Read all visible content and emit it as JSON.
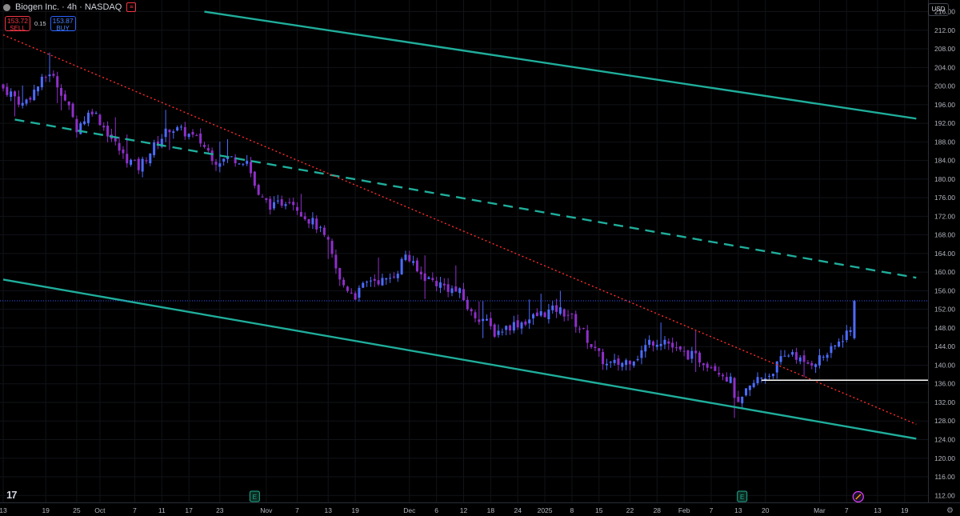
{
  "header": {
    "symbol_title": "Biogen Inc. · 4h · NASDAQ",
    "sell_price": "153.72",
    "sell_label": "SELL",
    "spread": "0.15",
    "buy_price": "153.87",
    "buy_label": "BUY",
    "currency": "USD"
  },
  "icons": {
    "logo": "tradingview-logo",
    "settings": "gear-icon",
    "earnings": "earnings-marker-icon",
    "dividend": "dividend-marker-icon"
  },
  "colors": {
    "up": "#4c6cff",
    "down": "#8f2fc9",
    "channel": "#1fae9b",
    "trendline": "#ff2b2b",
    "price_line": "#3656ff",
    "level_line": "#ffffff",
    "last_price_bg": "#2962ff"
  },
  "chart_data": {
    "type": "candlestick",
    "interval": "4h",
    "y_axis": {
      "ticks": [
        "112.00",
        "116.00",
        "120.00",
        "124.00",
        "128.00",
        "132.00",
        "136.00",
        "140.00",
        "144.00",
        "148.00",
        "152.00",
        "156.00",
        "160.00",
        "164.00",
        "168.00",
        "172.00",
        "176.00",
        "180.00",
        "184.00",
        "188.00",
        "192.00",
        "196.00",
        "200.00",
        "204.00",
        "208.00",
        "212.00",
        "216.00"
      ],
      "ylim": [
        110.5,
        218.5
      ]
    },
    "x_axis": {
      "ticks": [
        {
          "label": "13",
          "slot": 0
        },
        {
          "label": "19",
          "slot": 11
        },
        {
          "label": "25",
          "slot": 19
        },
        {
          "label": "Oct",
          "slot": 25
        },
        {
          "label": "7",
          "slot": 34
        },
        {
          "label": "11",
          "slot": 41
        },
        {
          "label": "17",
          "slot": 48
        },
        {
          "label": "23",
          "slot": 56
        },
        {
          "label": "Nov",
          "slot": 68
        },
        {
          "label": "7",
          "slot": 76
        },
        {
          "label": "13",
          "slot": 84
        },
        {
          "label": "19",
          "slot": 91
        },
        {
          "label": "Dec",
          "slot": 105
        },
        {
          "label": "6",
          "slot": 112
        },
        {
          "label": "12",
          "slot": 119
        },
        {
          "label": "18",
          "slot": 126
        },
        {
          "label": "24",
          "slot": 133
        },
        {
          "label": "2025",
          "slot": 140
        },
        {
          "label": "8",
          "slot": 147
        },
        {
          "label": "15",
          "slot": 154
        },
        {
          "label": "22",
          "slot": 162
        },
        {
          "label": "28",
          "slot": 169
        },
        {
          "label": "Feb",
          "slot": 176
        },
        {
          "label": "7",
          "slot": 183
        },
        {
          "label": "13",
          "slot": 190
        },
        {
          "label": "20",
          "slot": 197
        },
        {
          "label": "Mar",
          "slot": 211
        },
        {
          "label": "7",
          "slot": 218
        },
        {
          "label": "13",
          "slot": 226
        },
        {
          "label": "19",
          "slot": 233
        }
      ],
      "total_slots": 238
    },
    "last_price": {
      "value": 153.84,
      "countdown": "02:13:17"
    },
    "level": {
      "value": 136.77,
      "label": "136.77"
    },
    "lines": [
      {
        "name": "",
        "style": "solid",
        "from": {
          "slot": 52,
          "price": 216.0
        },
        "to": {
          "slot": 236,
          "price": 193.0
        }
      },
      {
        "name": "",
        "style": "solid",
        "from": {
          "slot": 0,
          "price": 158.4
        },
        "to": {
          "slot": 236,
          "price": 124.2
        }
      },
      {
        "name": "",
        "style": "dashed",
        "from": {
          "slot": 3,
          "price": 192.8
        },
        "to": {
          "slot": 236,
          "price": 158.8
        }
      },
      {
        "name": "",
        "style": "dotted",
        "from": {
          "slot": 0,
          "price": 211.0
        },
        "to": {
          "slot": 236,
          "price": 127.3
        }
      }
    ],
    "markers": [
      {
        "type": "E",
        "slot": 65
      },
      {
        "type": "E",
        "slot": 191
      },
      {
        "type": "D",
        "slot": 221
      }
    ],
    "anchors": [
      [
        0,
        199.5
      ],
      [
        2,
        198.5
      ],
      [
        5,
        196
      ],
      [
        8,
        199
      ],
      [
        12,
        203
      ],
      [
        15,
        199
      ],
      [
        19,
        191
      ],
      [
        23,
        195
      ],
      [
        27,
        190
      ],
      [
        31,
        185
      ],
      [
        35,
        182.5
      ],
      [
        39,
        187
      ],
      [
        43,
        191
      ],
      [
        47,
        190
      ],
      [
        51,
        188
      ],
      [
        55,
        184
      ],
      [
        59,
        184.5
      ],
      [
        63,
        184
      ],
      [
        66,
        176
      ],
      [
        70,
        174
      ],
      [
        74,
        176
      ],
      [
        78,
        172
      ],
      [
        81,
        170
      ],
      [
        84,
        166
      ],
      [
        87,
        158
      ],
      [
        91,
        155
      ],
      [
        95,
        158.5
      ],
      [
        99,
        158
      ],
      [
        102,
        160.5
      ],
      [
        104,
        164
      ],
      [
        107,
        160
      ],
      [
        110,
        158.5
      ],
      [
        114,
        157
      ],
      [
        118,
        155.5
      ],
      [
        121,
        151
      ],
      [
        124,
        150
      ],
      [
        127,
        147
      ],
      [
        131,
        148.5
      ],
      [
        135,
        149.5
      ],
      [
        139,
        151
      ],
      [
        143,
        152
      ],
      [
        146,
        151
      ],
      [
        150,
        147
      ],
      [
        153,
        143
      ],
      [
        156,
        140
      ],
      [
        160,
        140.5
      ],
      [
        164,
        142
      ],
      [
        167,
        145
      ],
      [
        171,
        145.5
      ],
      [
        174,
        143
      ],
      [
        178,
        142
      ],
      [
        182,
        140.5
      ],
      [
        185,
        139
      ],
      [
        188,
        136.5
      ],
      [
        190,
        131
      ],
      [
        192,
        134
      ],
      [
        195,
        137
      ],
      [
        198,
        138
      ],
      [
        201,
        141
      ],
      [
        204,
        143
      ],
      [
        207,
        140
      ],
      [
        210,
        141
      ],
      [
        214,
        143
      ],
      [
        218,
        147
      ],
      [
        220,
        153.84
      ]
    ]
  }
}
